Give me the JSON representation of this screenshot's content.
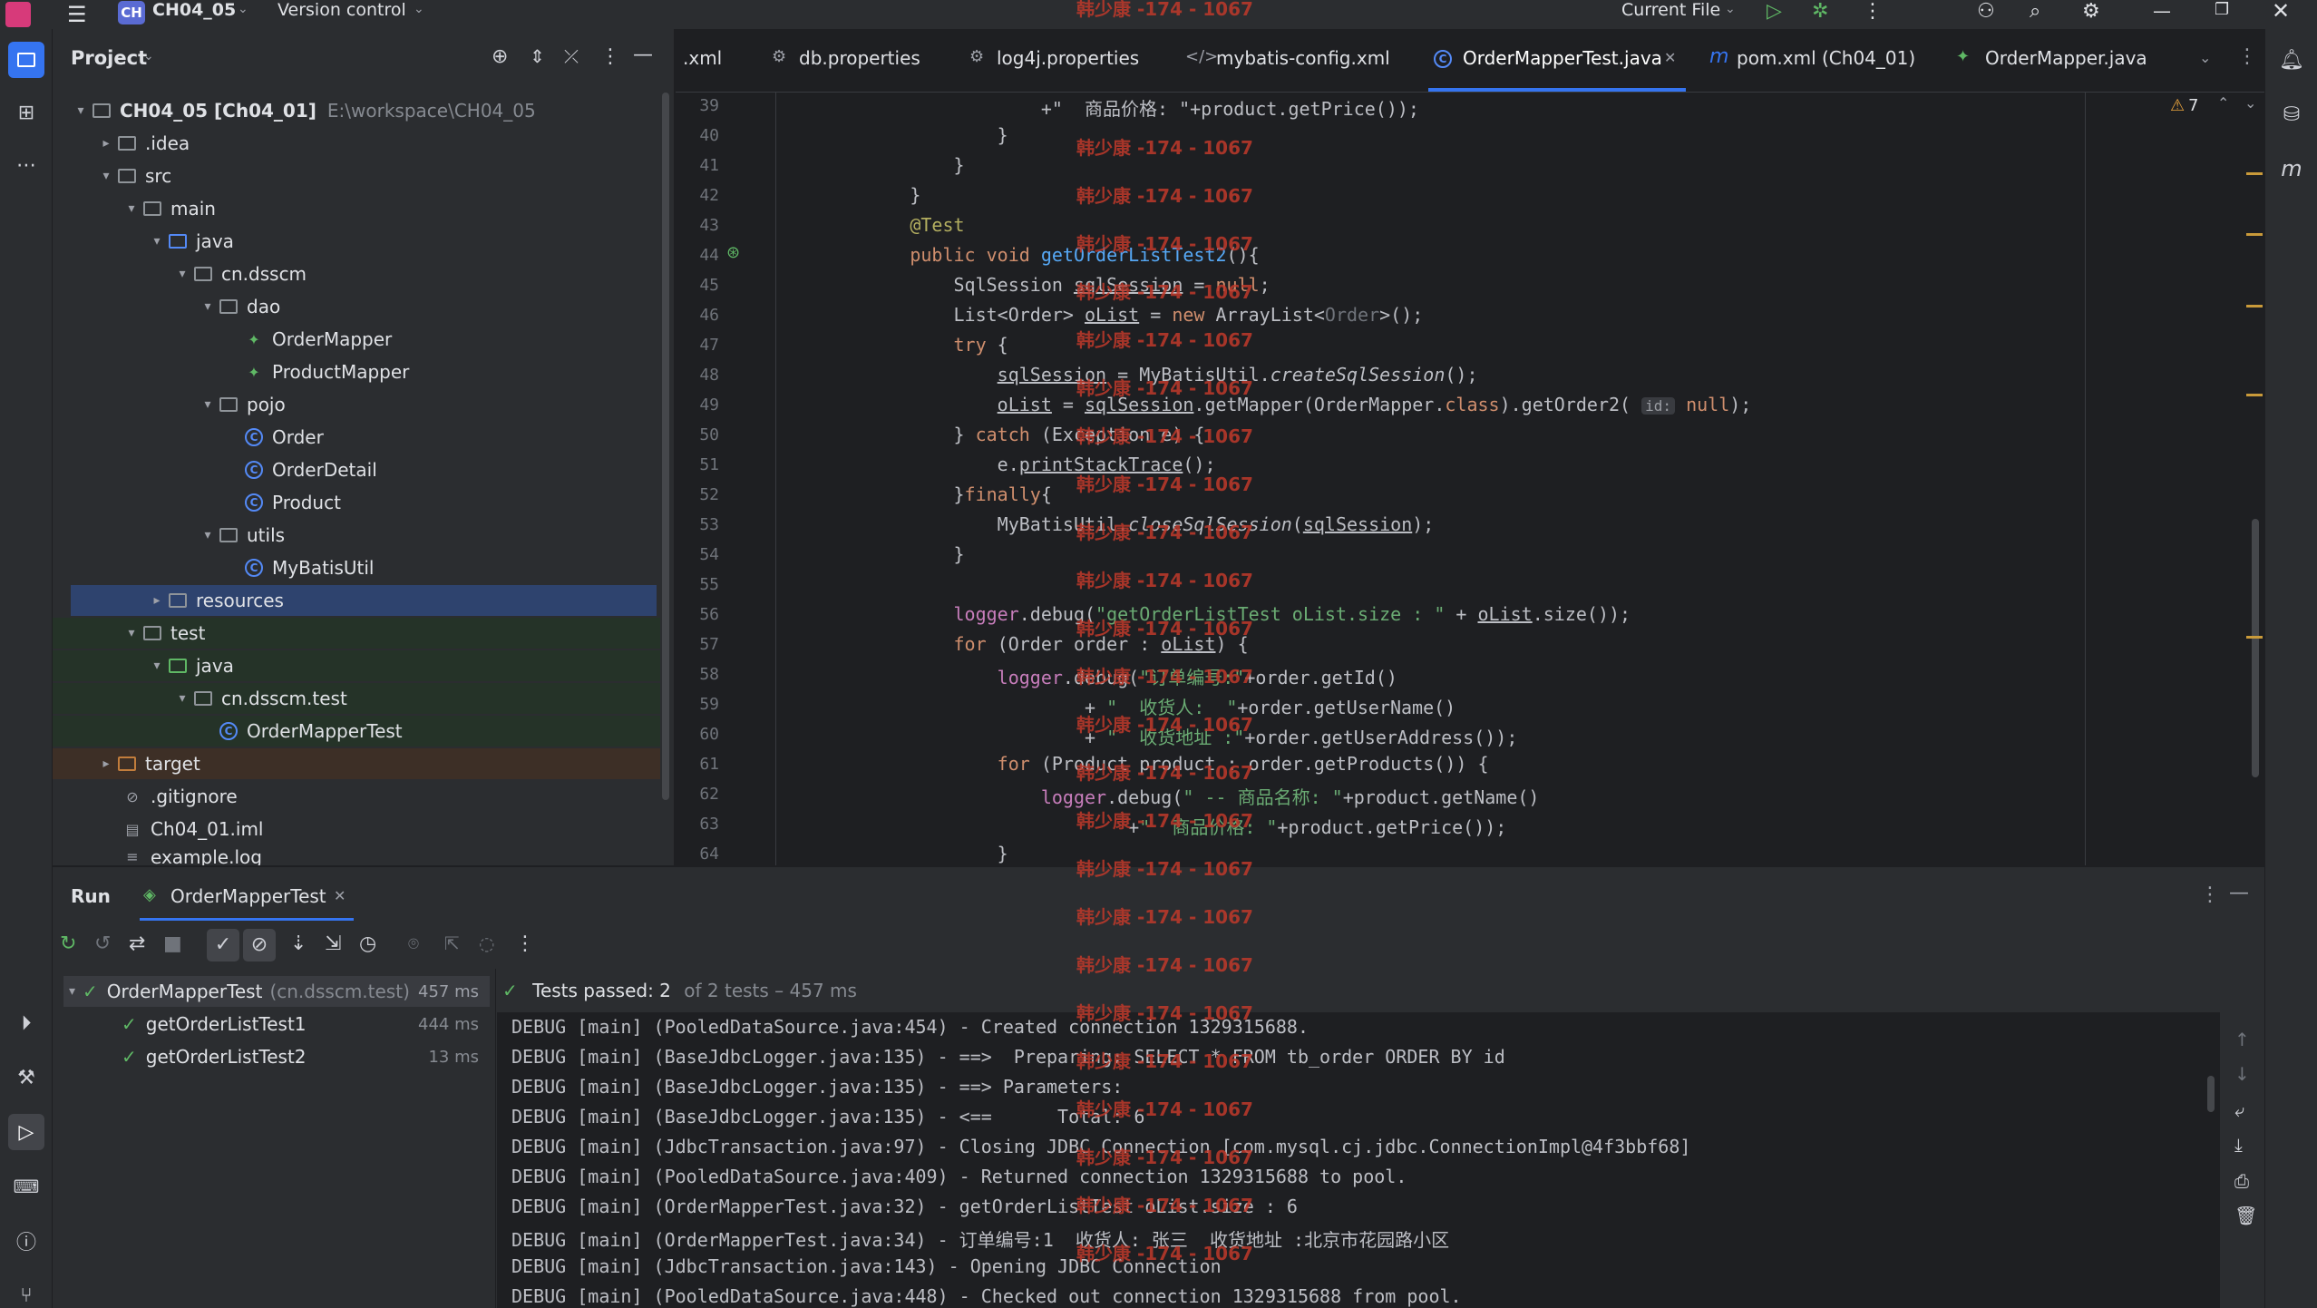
{
  "titlebar": {
    "project_badge": "CH",
    "project_name": "CH04_05",
    "vcs": "Version control",
    "run_config": "Current File"
  },
  "project_panel": {
    "title": "Project",
    "root_name": "CH04_05 [Ch04_01]",
    "root_path": "E:\\workspace\\CH04_05",
    "items": [
      {
        "label": ".idea"
      },
      {
        "label": "src"
      },
      {
        "label": "main"
      },
      {
        "label": "java"
      },
      {
        "label": "cn.dsscm"
      },
      {
        "label": "dao"
      },
      {
        "label": "OrderMapper"
      },
      {
        "label": "ProductMapper"
      },
      {
        "label": "pojo"
      },
      {
        "label": "Order"
      },
      {
        "label": "OrderDetail"
      },
      {
        "label": "Product"
      },
      {
        "label": "utils"
      },
      {
        "label": "MyBatisUtil"
      },
      {
        "label": "resources"
      },
      {
        "label": "test"
      },
      {
        "label": "java"
      },
      {
        "label": "cn.dsscm.test"
      },
      {
        "label": "OrderMapperTest"
      },
      {
        "label": "target"
      },
      {
        "label": ".gitignore"
      },
      {
        "label": "Ch04_01.iml"
      },
      {
        "label": "example.log"
      }
    ]
  },
  "tabs": [
    {
      "label": ".xml"
    },
    {
      "label": "db.properties"
    },
    {
      "label": "log4j.properties"
    },
    {
      "label": "mybatis-config.xml"
    },
    {
      "label": "OrderMapperTest.java"
    },
    {
      "label": "pom.xml (Ch04_01)"
    },
    {
      "label": "OrderMapper.java"
    }
  ],
  "editor": {
    "warnings": "7",
    "line_numbers": [
      "39",
      "40",
      "41",
      "42",
      "43",
      "44",
      "45",
      "46",
      "47",
      "48",
      "49",
      "50",
      "51",
      "52",
      "53",
      "54",
      "55",
      "56",
      "57",
      "58",
      "59",
      "60",
      "61",
      "62",
      "63",
      "64"
    ],
    "param_hint": "id:",
    "watermark": "韩少康 -174 - 1067"
  },
  "run_panel": {
    "tab_run": "Run",
    "tab_config": "OrderMapperTest",
    "status": "Tests passed: 2",
    "status_detail": "of 2 tests – 457 ms",
    "tests": [
      {
        "name": "OrderMapperTest",
        "pkg": "(cn.dsscm.test)",
        "time": "457 ms"
      },
      {
        "name": "getOrderListTest1",
        "pkg": "",
        "time": "444 ms"
      },
      {
        "name": "getOrderListTest2",
        "pkg": "",
        "time": "13 ms"
      }
    ],
    "console": [
      "DEBUG [main] (PooledDataSource.java:454) - Created connection 1329315688.",
      "DEBUG [main] (BaseJdbcLogger.java:135) - ==>  Preparing: SELECT * FROM tb_order ORDER BY id",
      "DEBUG [main] (BaseJdbcLogger.java:135) - ==> Parameters: ",
      "DEBUG [main] (BaseJdbcLogger.java:135) - <==      Total: 6",
      "DEBUG [main] (JdbcTransaction.java:97) - Closing JDBC Connection [com.mysql.cj.jdbc.ConnectionImpl@4f3bbf68]",
      "DEBUG [main] (PooledDataSource.java:409) - Returned connection 1329315688 to pool.",
      "DEBUG [main] (OrderMapperTest.java:32) - getOrderListTest oList.size : 6",
      "DEBUG [main] (OrderMapperTest.java:34) - 订单编号:1  收货人: 张三  收货地址 :北京市花园路小区",
      "DEBUG [main] (JdbcTransaction.java:143) - Opening JDBC Connection",
      "DEBUG [main] (PooledDataSource.java:448) - Checked out connection 1329315688 from pool."
    ]
  }
}
